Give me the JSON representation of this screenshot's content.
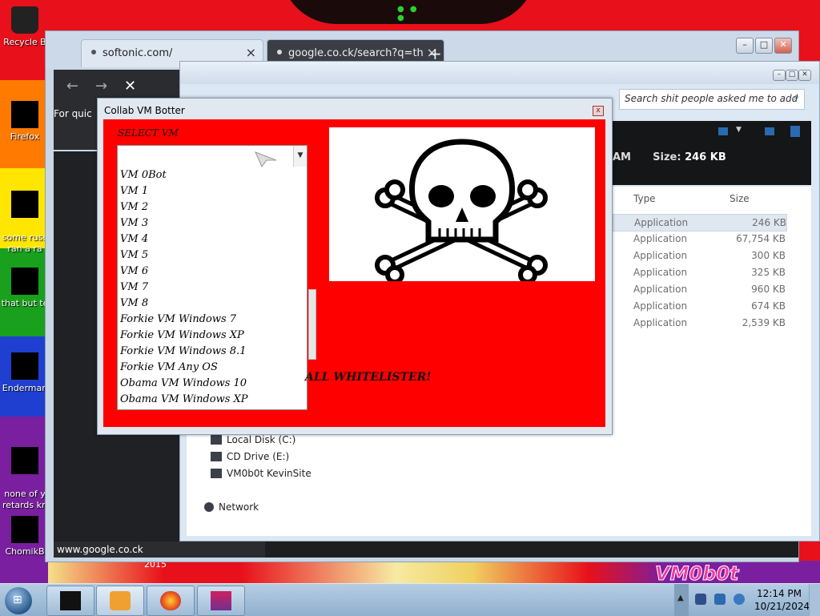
{
  "desktop": {
    "icons": [
      {
        "label": "Recycle B"
      },
      {
        "label": "Firefox"
      },
      {
        "label": "some russ\nran a ra"
      },
      {
        "label": "that but te"
      },
      {
        "label": "Enderman"
      },
      {
        "label": "none of y\nretards kn"
      },
      {
        "label": "ChomikB"
      }
    ],
    "wallpaper_year": "2015",
    "wallpaper_logo": "VM0b0t"
  },
  "browser": {
    "tabs": [
      {
        "title": "softonic.com/",
        "close": "×"
      },
      {
        "title": "google.co.ck/search?q=the+m",
        "close": "×"
      }
    ],
    "new_tab": "+",
    "nav": {
      "back": "←",
      "forward": "→",
      "stop": "✕"
    },
    "page_snippet": "For quic",
    "status_url": "www.google.co.ck",
    "window_buttons": {
      "min": "–",
      "max": "□",
      "close": "✕"
    }
  },
  "explorer": {
    "search_placeholder": "Search shit people asked me to add",
    "meta_time": "AM",
    "meta_size_label": "Size:",
    "meta_size_value": "246 KB",
    "columns": {
      "type": "Type",
      "size": "Size"
    },
    "rows": [
      {
        "type": "Application",
        "size": "246 KB"
      },
      {
        "type": "Application",
        "size": "67,754 KB"
      },
      {
        "type": "Application",
        "size": "300 KB"
      },
      {
        "type": "Application",
        "size": "325 KB"
      },
      {
        "type": "Application",
        "size": "960 KB"
      },
      {
        "type": "Application",
        "size": "674 KB"
      },
      {
        "type": "Application",
        "size": "2,539 KB"
      }
    ],
    "tree": [
      {
        "label": "Local Disk (C:)"
      },
      {
        "label": "CD Drive (E:)"
      },
      {
        "label": "VM0b0t KevinSite"
      },
      {
        "label": "Network"
      }
    ]
  },
  "dialog": {
    "title": "Collab VM Botter",
    "close": "x",
    "select_label": "SELECT VM",
    "selected_value": "",
    "options": [
      "VM 0Bot",
      "VM 1",
      "VM 2",
      "VM 3",
      "VM 4",
      "VM 5",
      "VM 6",
      "VM 7",
      "VM 8",
      "Forkie VM Windows 7",
      "Forkie VM Windows XP",
      "Forkie VM Windows 8.1",
      "Forkie VM Any OS",
      "Obama VM Windows 10",
      "Obama VM Windows XP"
    ],
    "whitelist_text": "ALL WHITELISTER!"
  },
  "taskbar": {
    "time": "12:14 PM",
    "date": "10/21/2024",
    "tray_up": "▲"
  },
  "colors": {
    "wallpaper_red": "#e8101a",
    "dialog_red": "#ff0000",
    "taskbar": "#9fbcd8"
  }
}
